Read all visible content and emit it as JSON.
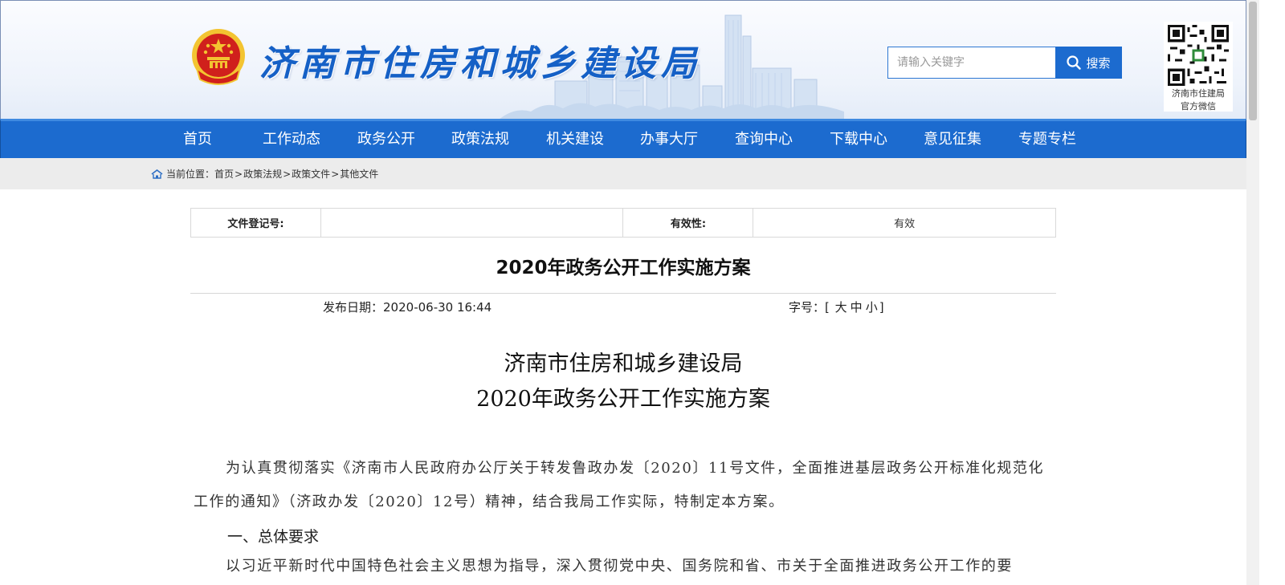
{
  "header": {
    "site_title": "济南市住房和城乡建设局",
    "search_placeholder": "请输入关键字",
    "search_button": "搜索",
    "qr_caption_line1": "济南市住建局",
    "qr_caption_line2": "官方微信"
  },
  "nav": {
    "items": [
      "首页",
      "工作动态",
      "政务公开",
      "政策法规",
      "机关建设",
      "办事大厅",
      "查询中心",
      "下载中心",
      "意见征集",
      "专题专栏"
    ]
  },
  "breadcrumb": {
    "prefix": "当前位置：",
    "items": [
      "首页",
      "政策法规",
      "政策文件",
      "其他文件"
    ],
    "separator": ">"
  },
  "info": {
    "reg_label": "文件登记号:",
    "reg_value": "",
    "validity_label": "有效性:",
    "validity_value": "有效"
  },
  "article": {
    "title": "2020年政务公开工作实施方案",
    "date_label": "发布日期：",
    "date": "2020-06-30 16:44",
    "font_label": "字号：",
    "font_open": "[",
    "font_large": "大",
    "font_medium": "中",
    "font_small": "小",
    "font_close": "]",
    "body_title_line1": "济南市住房和城乡建设局",
    "body_title_line2": "2020年政务公开工作实施方案",
    "para1": "为认真贯彻落实《济南市人民政府办公厅关于转发鲁政办发〔2020〕11号文件，全面推进基层政务公开标准化规范化工作的通知》（济政办发〔2020〕12号）精神，结合我局工作实际，特制定本方案。",
    "heading1": "一、总体要求",
    "para2": "以习近平新时代中国特色社会主义思想为指导，深入贯彻党中央、国务院和省、市关于全面推进政务公开工作的要"
  },
  "colors": {
    "nav_blue": "#1c6bcf",
    "title_blue": "#1560c6",
    "emblem_red": "#d0201c",
    "emblem_gold": "#f3c431"
  }
}
